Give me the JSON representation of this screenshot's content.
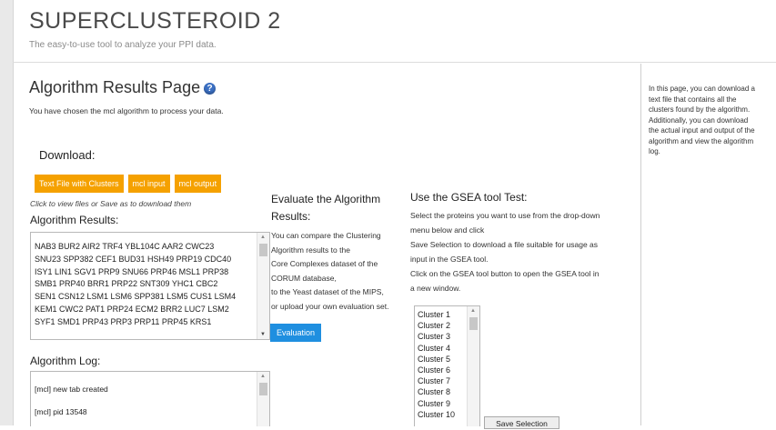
{
  "app": {
    "title": "SUPERCLUSTEROID 2",
    "subtitle": "The easy-to-use tool to analyze your PPI data."
  },
  "page": {
    "title": "Algorithm Results Page",
    "help_icon": "?",
    "intro": "You have chosen the mcl algorithm to process your data."
  },
  "download": {
    "heading": "Download:",
    "buttons": [
      "Text File with Clusters",
      "mcl input",
      "mcl output"
    ],
    "hint": "Click to view files or Save as to download them"
  },
  "results": {
    "heading": "Algorithm Results:",
    "lines": [
      "NAB3 BUR2 AIR2 TRF4 YBL104C AAR2 CWC23",
      "SNU23 SPP382 CEF1 BUD31 HSH49 PRP19 CDC40",
      "ISY1 LIN1 SGV1 PRP9 SNU66 PRP46 MSL1 PRP38",
      "SMB1 PRP40 BRR1 PRP22 SNT309 YHC1 CBC2",
      "SEN1 CSN12 LSM1 LSM6 SPP381 LSM5 CUS1 LSM4",
      "KEM1 CWC2 PAT1 PRP24 ECM2 BRR2 LUC7 LSM2",
      "SYF1 SMD1 PRP43 PRP3 PRP11 PRP45 KRS1"
    ]
  },
  "log": {
    "heading": "Algorithm Log:",
    "lines": [
      "[mcl] new tab created",
      "[mcl] pid 13548"
    ]
  },
  "evaluate": {
    "heading_line1": "Evaluate the Algorithm",
    "heading_line2": "Results:",
    "lines": [
      "You can compare the Clustering",
      "Algorithm results to the",
      "Core Complexes dataset of the",
      "CORUM database,",
      "to the Yeast dataset of the MIPS,",
      "or upload your own evaluation set."
    ],
    "button": "Evaluation"
  },
  "gsea": {
    "heading": "Use the GSEA tool Test:",
    "lines": [
      "Select the proteins you want to use from the drop-down",
      "menu below and click",
      "Save Selection to download a file suitable for usage as",
      "input in the GSEA tool.",
      "Click on the GSEA tool button to open the GSEA tool in",
      "a new window."
    ],
    "clusters": [
      "Cluster 1",
      "Cluster 2",
      "Cluster 3",
      "Cluster 4",
      "Cluster 5",
      "Cluster 6",
      "Cluster 7",
      "Cluster 8",
      "Cluster 9",
      "Cluster 10"
    ],
    "save_button": "Save Selection"
  },
  "sidebar": {
    "lines": [
      "In this page, you can download a",
      "text file that contains all the",
      "clusters found by the algorithm.",
      "Additionally, you can download",
      "the actual input and output of the",
      "algorithm and view the algorithm",
      "log."
    ]
  }
}
